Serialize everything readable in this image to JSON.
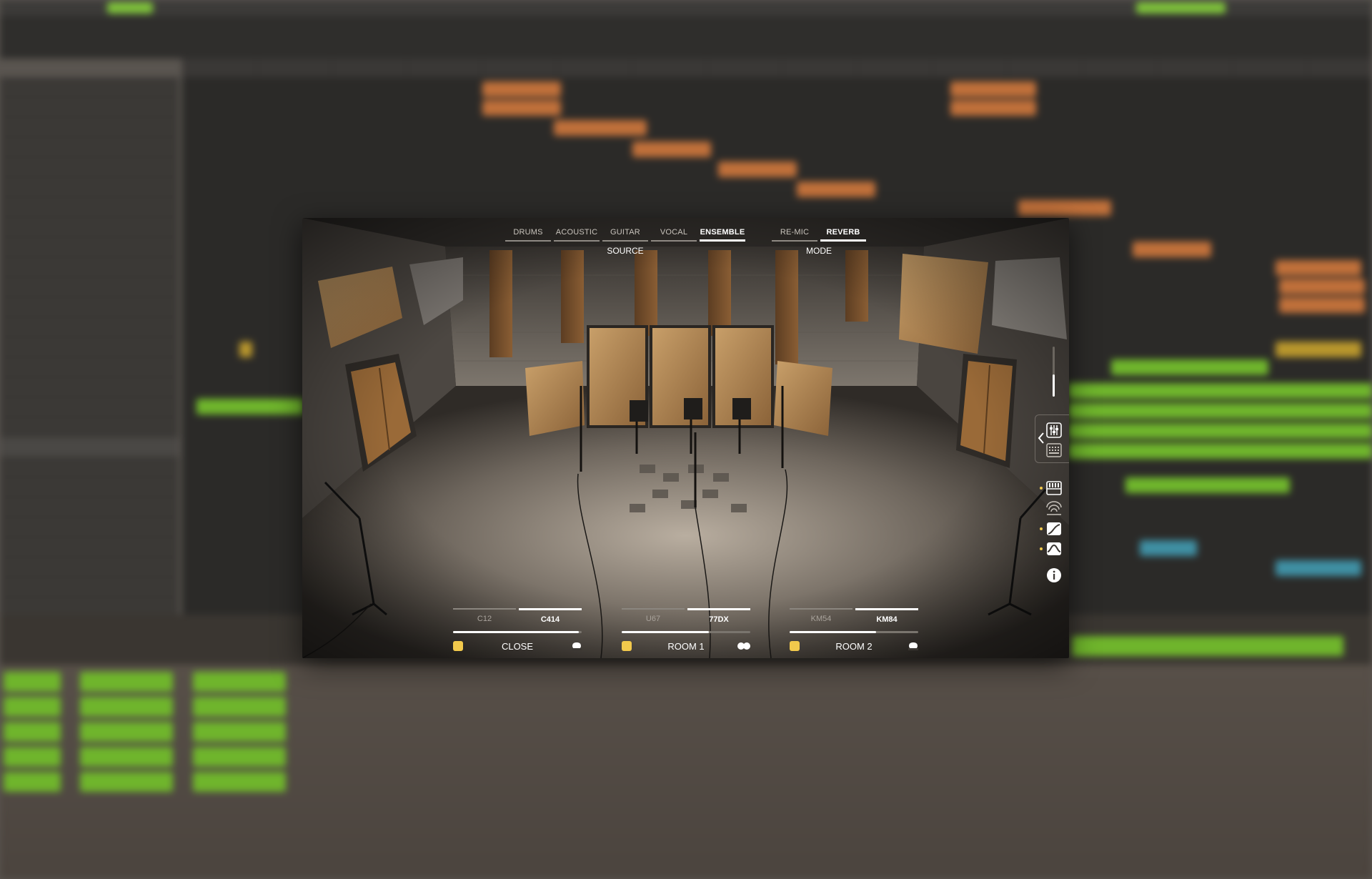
{
  "plugin": {
    "source": {
      "label": "SOURCE",
      "tabs": [
        {
          "label": "DRUMS",
          "active": false
        },
        {
          "label": "ACOUSTIC",
          "active": false
        },
        {
          "label": "GUITAR",
          "active": false
        },
        {
          "label": "VOCAL",
          "active": false
        },
        {
          "label": "ENSEMBLE",
          "active": true
        }
      ]
    },
    "mode": {
      "label": "MODE",
      "tabs": [
        {
          "label": "RE-MIC",
          "active": false
        },
        {
          "label": "REVERB",
          "active": true
        }
      ]
    },
    "mics": [
      {
        "position": "CLOSE",
        "options": [
          "C12",
          "C414"
        ],
        "selected": "C414",
        "level": 0.98,
        "enabled": true,
        "pattern": "cardioid-icon"
      },
      {
        "position": "ROOM 1",
        "options": [
          "U67",
          "77DX"
        ],
        "selected": "77DX",
        "level": 0.68,
        "enabled": true,
        "pattern": "figure-eight-icon"
      },
      {
        "position": "ROOM 2",
        "options": [
          "KM54",
          "KM84"
        ],
        "selected": "KM84",
        "level": 0.67,
        "enabled": true,
        "pattern": "cardioid-icon"
      }
    ],
    "side_panel": {
      "output_level": 0.45,
      "buttons": [
        "collapse-chevron-icon",
        "mixer-icon",
        "keyboard-grid-icon",
        "piano-keys-icon",
        "reverb-waves-icon",
        "curve-icon",
        "eq-icon",
        "info-icon"
      ]
    }
  },
  "colors": {
    "accent": "#f2c94c",
    "active_text": "#ffffff",
    "inactive_text": "#c8c3bc",
    "region_orange": "#c0703a",
    "region_green": "#6fb52c",
    "region_blue": "#3f8fa3"
  }
}
